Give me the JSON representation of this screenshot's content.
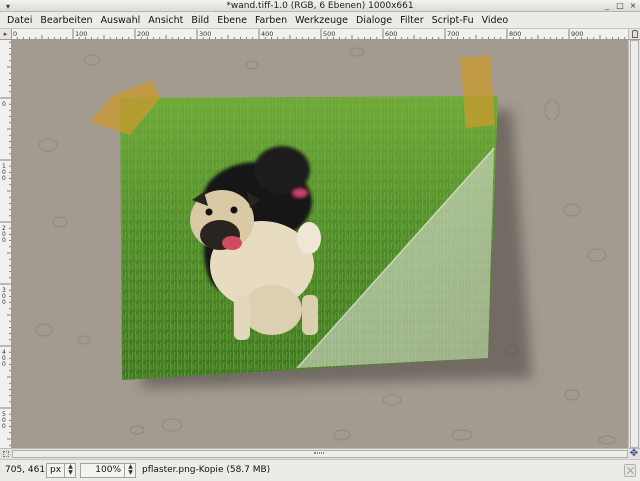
{
  "window": {
    "title": "*wand.tiff-1.0 (RGB, 6 Ebenen) 1000x661"
  },
  "menu": {
    "items": [
      "Datei",
      "Bearbeiten",
      "Auswahl",
      "Ansicht",
      "Bild",
      "Ebene",
      "Farben",
      "Werkzeuge",
      "Dialoge",
      "Filter",
      "Script-Fu",
      "Video"
    ]
  },
  "ruler": {
    "horizontal_labels": [
      "0",
      "100",
      "200",
      "300",
      "400",
      "500",
      "600",
      "700",
      "800",
      "900"
    ],
    "vertical_labels": [
      "0",
      "100",
      "200",
      "300",
      "400",
      "500",
      "600"
    ]
  },
  "status": {
    "coords": "705, 461",
    "unit": "px",
    "zoom": "100%",
    "message": "pflaster.png-Kopie (58.7 MB)"
  },
  "colors": {
    "wall": "#a39b90",
    "tape": "#c89a2e",
    "grass": "#4f8a2a"
  },
  "icons": {
    "window_menu": "window-menu-icon",
    "minimize": "minimize-icon",
    "maximize": "maximize-icon",
    "close": "close-icon",
    "ruler_corner": "pointer-menu-icon",
    "zoom_lock": "zoom-lock-icon",
    "quickmask": "quick-mask-icon",
    "navigate": "navigate-icon",
    "cancel": "cancel-icon"
  }
}
